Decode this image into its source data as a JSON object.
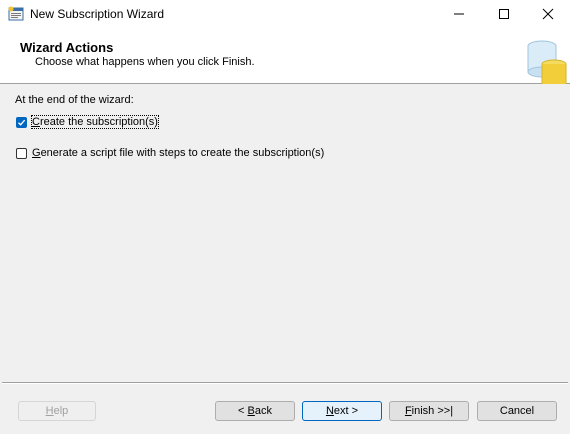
{
  "window": {
    "title": "New Subscription Wizard",
    "controls": [
      "minimize",
      "maximize",
      "close"
    ]
  },
  "header": {
    "title": "Wizard Actions",
    "subtitle": "Choose what happens when you click Finish."
  },
  "body": {
    "section_label": "At the end of the wizard:",
    "options": [
      {
        "label_pre": "",
        "label_mnemonic": "C",
        "label_post": "reate the subscription(s)",
        "checked": true
      },
      {
        "label_pre": "",
        "label_mnemonic": "G",
        "label_post": "enerate a script file with steps to create the subscription(s)",
        "checked": false
      }
    ]
  },
  "footer": {
    "help": {
      "mnemonic": "H",
      "rest": "elp",
      "enabled": false
    },
    "back": {
      "pre": "< ",
      "mnemonic": "B",
      "rest": "ack"
    },
    "next": {
      "pre": "",
      "mnemonic": "N",
      "rest": "ext >"
    },
    "finish": {
      "pre": "",
      "mnemonic": "F",
      "rest": "inish >>|"
    },
    "cancel": {
      "label": "Cancel"
    }
  },
  "colors": {
    "accent": "#0067c0",
    "background": "#f0f0f0"
  }
}
